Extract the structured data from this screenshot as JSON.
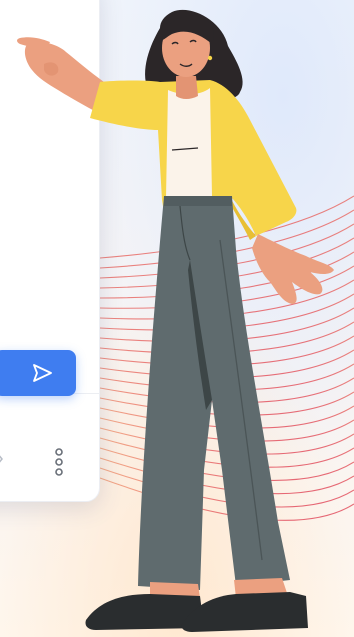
{
  "illustration": {
    "subject": "woman-pointing",
    "colors": {
      "cardigan": "#f7d54a",
      "trousers": "#5f6b6e",
      "skin": "#eba080",
      "hair": "#2b2628",
      "top": "#fbf3ea",
      "shoes": "#2a2d2f",
      "lines_start": "#f08a6a",
      "lines_end": "#e0445c"
    }
  },
  "chat_panel": {
    "send_icon": "send-icon",
    "more_icon": "more-vertical-icon",
    "accent_color": "#3f7df0"
  }
}
